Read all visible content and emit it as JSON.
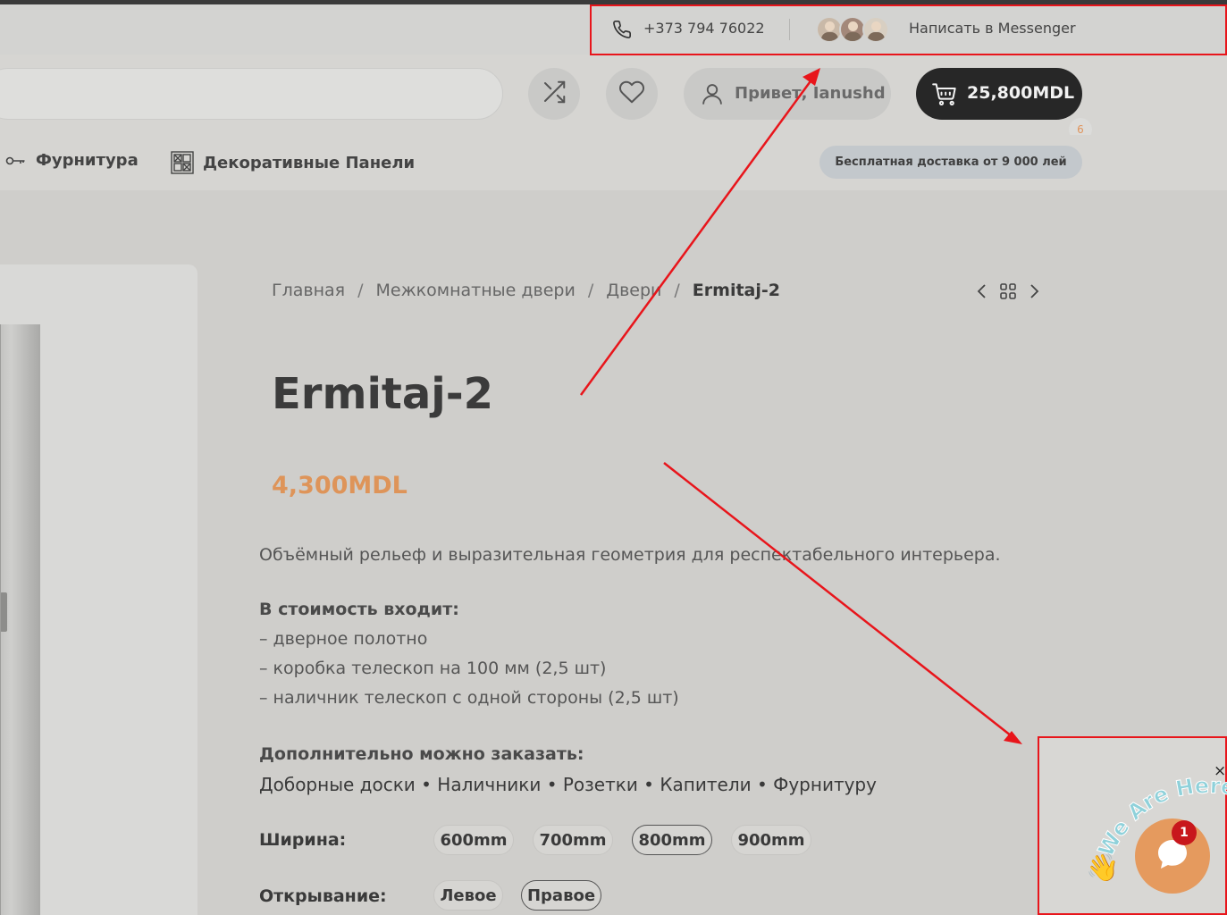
{
  "topbar": {
    "phone": "+373 794 76022",
    "messenger_label": "Написать в Messenger",
    "avatars": [
      "avatar-1",
      "avatar-2",
      "avatar-3"
    ]
  },
  "header": {
    "search_placeholder": "",
    "greeting": "Привет, Ianushd",
    "cart_total": "25,800MDL",
    "cart_count": "6"
  },
  "nav": {
    "items": [
      {
        "label": "Фурнитура",
        "icon": "key-icon"
      },
      {
        "label": "Декоративные Панели",
        "icon": "panels-icon"
      }
    ],
    "delivery_note": "Бесплатная доставка от 9 000 лей"
  },
  "breadcrumb": {
    "items": [
      "Главная",
      "Межкомнатные двери",
      "Двери"
    ],
    "separator": "/",
    "current": "Ermitaj-2"
  },
  "product": {
    "title": "Ermitaj-2",
    "price": "4,300MDL",
    "description": "Объёмный рельеф и выразительная геометрия для респектабельного интерьера.",
    "includes_title": "В стоимость входит:",
    "includes": [
      "– дверное полотно",
      "– коробка телескоп на 100 мм (2,5 шт)",
      "– наличник телескоп с одной стороны (2,5 шт)"
    ],
    "extra_title": "Дополнительно можно заказать:",
    "extra": "Доборные доски • Наличники • Розетки • Капители • Фурнитуру"
  },
  "options": {
    "width": {
      "label": "Ширина:",
      "values": [
        "600mm",
        "700mm",
        "800mm",
        "900mm"
      ],
      "selected": "800mm"
    },
    "opening": {
      "label": "Открывание:",
      "values": [
        "Левое",
        "Правое"
      ],
      "selected": "Правое"
    }
  },
  "chat": {
    "sticker": "We Are Here!",
    "count": "1",
    "close": "×"
  },
  "colors": {
    "accent_price": "#de9459",
    "cart_bg": "#272727",
    "chat_bubble": "#e59a5e",
    "annotation": "#e8151b"
  }
}
